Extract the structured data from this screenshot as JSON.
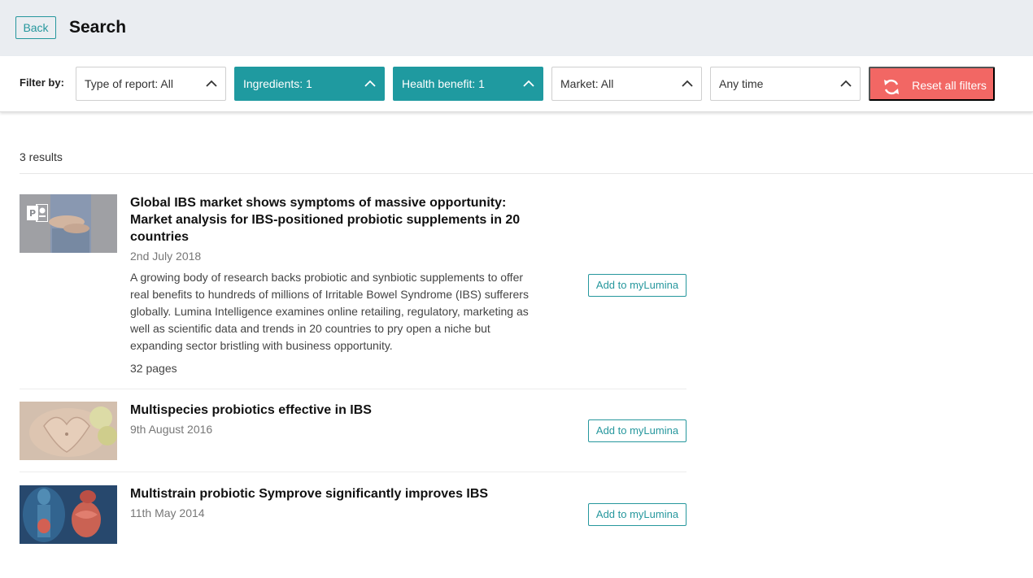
{
  "header": {
    "back_label": "Back",
    "title": "Search"
  },
  "filters": {
    "label": "Filter by:",
    "items": [
      {
        "label": "Type of report: All",
        "active": false
      },
      {
        "label": "Ingredients: 1",
        "active": true
      },
      {
        "label": "Health benefit: 1",
        "active": true
      },
      {
        "label": "Market: All",
        "active": false
      },
      {
        "label": "Any time",
        "active": false
      }
    ],
    "reset_label": "Reset all filters",
    "colors": {
      "active": "#1f9aa0",
      "reset": "#f26764"
    }
  },
  "results": {
    "count_text": "3 results",
    "items": [
      {
        "title": "Global IBS market shows symptoms of massive opportunity: Market analysis for IBS-positioned probiotic supplements in 20 countries",
        "date": "2nd July 2018",
        "description": "A growing body of research backs probiotic and synbiotic supplements to offer real benefits to hundreds of millions of Irritable Bowel Syndrome (IBS) sufferers globally. Lumina Intelligence examines online retailing, regulatory, marketing as well as scientific data and trends in 20 countries to pry open a niche but expanding sector bristling with business opportunity.",
        "pages": "32 pages",
        "button_label": "Add to myLumina",
        "thumb_icon": "powerpoint-icon"
      },
      {
        "title": "Multispecies probiotics effective in IBS",
        "date": "9th August 2016",
        "button_label": "Add to myLumina"
      },
      {
        "title": "Multistrain probiotic Symprove significantly improves IBS",
        "date": "11th May 2014",
        "button_label": "Add to myLumina"
      }
    ]
  }
}
